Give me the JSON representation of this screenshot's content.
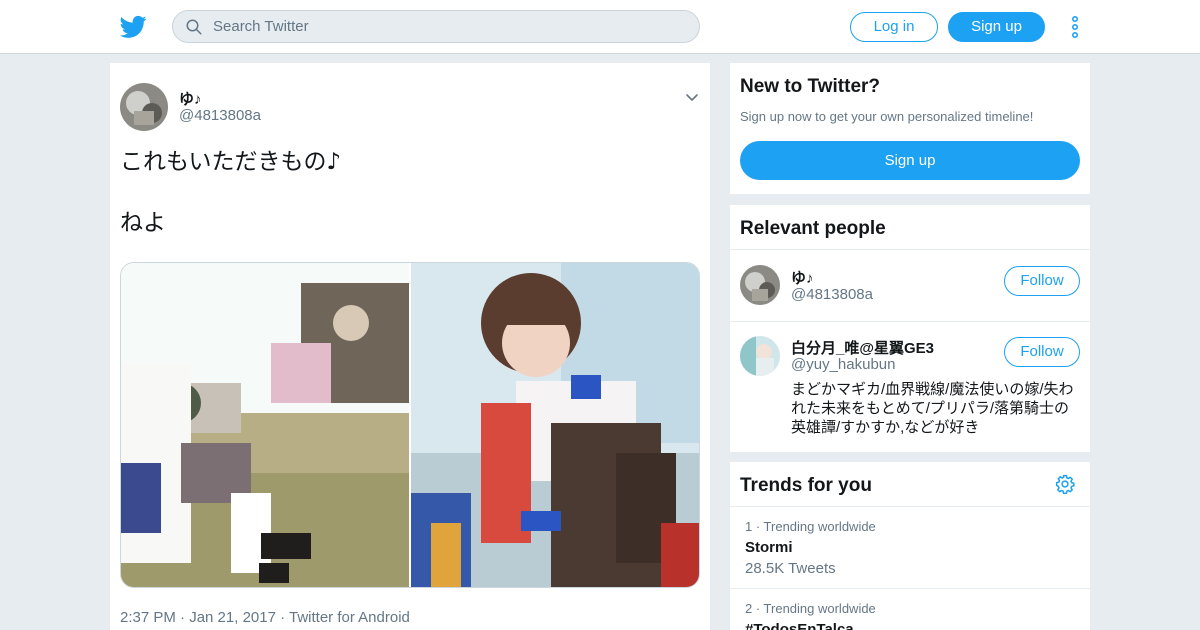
{
  "colors": {
    "accent": "#1da1f2",
    "background": "#e6ecf0",
    "muted": "#657786"
  },
  "header": {
    "logo_icon": "twitter-bird-icon",
    "search": {
      "placeholder": "Search Twitter",
      "icon": "search-icon"
    },
    "login_label": "Log in",
    "signup_label": "Sign up",
    "more_icon": "more-vertical-icon"
  },
  "tweet": {
    "author_name": "ゆ♪",
    "author_handle": "@4813808a",
    "text_line1": "これもいただきもの♪",
    "text_line2": "ねよ",
    "media_count": 2,
    "meta": "2:37 PM · Jan 21, 2017 · Twitter for Android"
  },
  "signup_card": {
    "title": "New to Twitter?",
    "subtitle": "Sign up now to get your own personalized timeline!",
    "button_label": "Sign up"
  },
  "relevant_people": {
    "title": "Relevant people",
    "people": [
      {
        "name": "ゆ♪",
        "handle": "@4813808a",
        "bio": "",
        "follow_label": "Follow"
      },
      {
        "name": "白分月_唯@星翼GE3",
        "handle": "@yuy_hakubun",
        "bio": "まどかマギカ/血界戦線/魔法使いの嫁/失われた未来をもとめて/プリパラ/落第騎士の英雄譚/すかすか,などが好き",
        "follow_label": "Follow"
      }
    ]
  },
  "trends": {
    "title": "Trends for you",
    "settings_icon": "gear-icon",
    "items": [
      {
        "meta": "1 · Trending worldwide",
        "name": "Stormi",
        "count": "28.5K Tweets"
      },
      {
        "meta": "2 · Trending worldwide",
        "name": "#TodosEnTalca",
        "count": ""
      }
    ]
  }
}
